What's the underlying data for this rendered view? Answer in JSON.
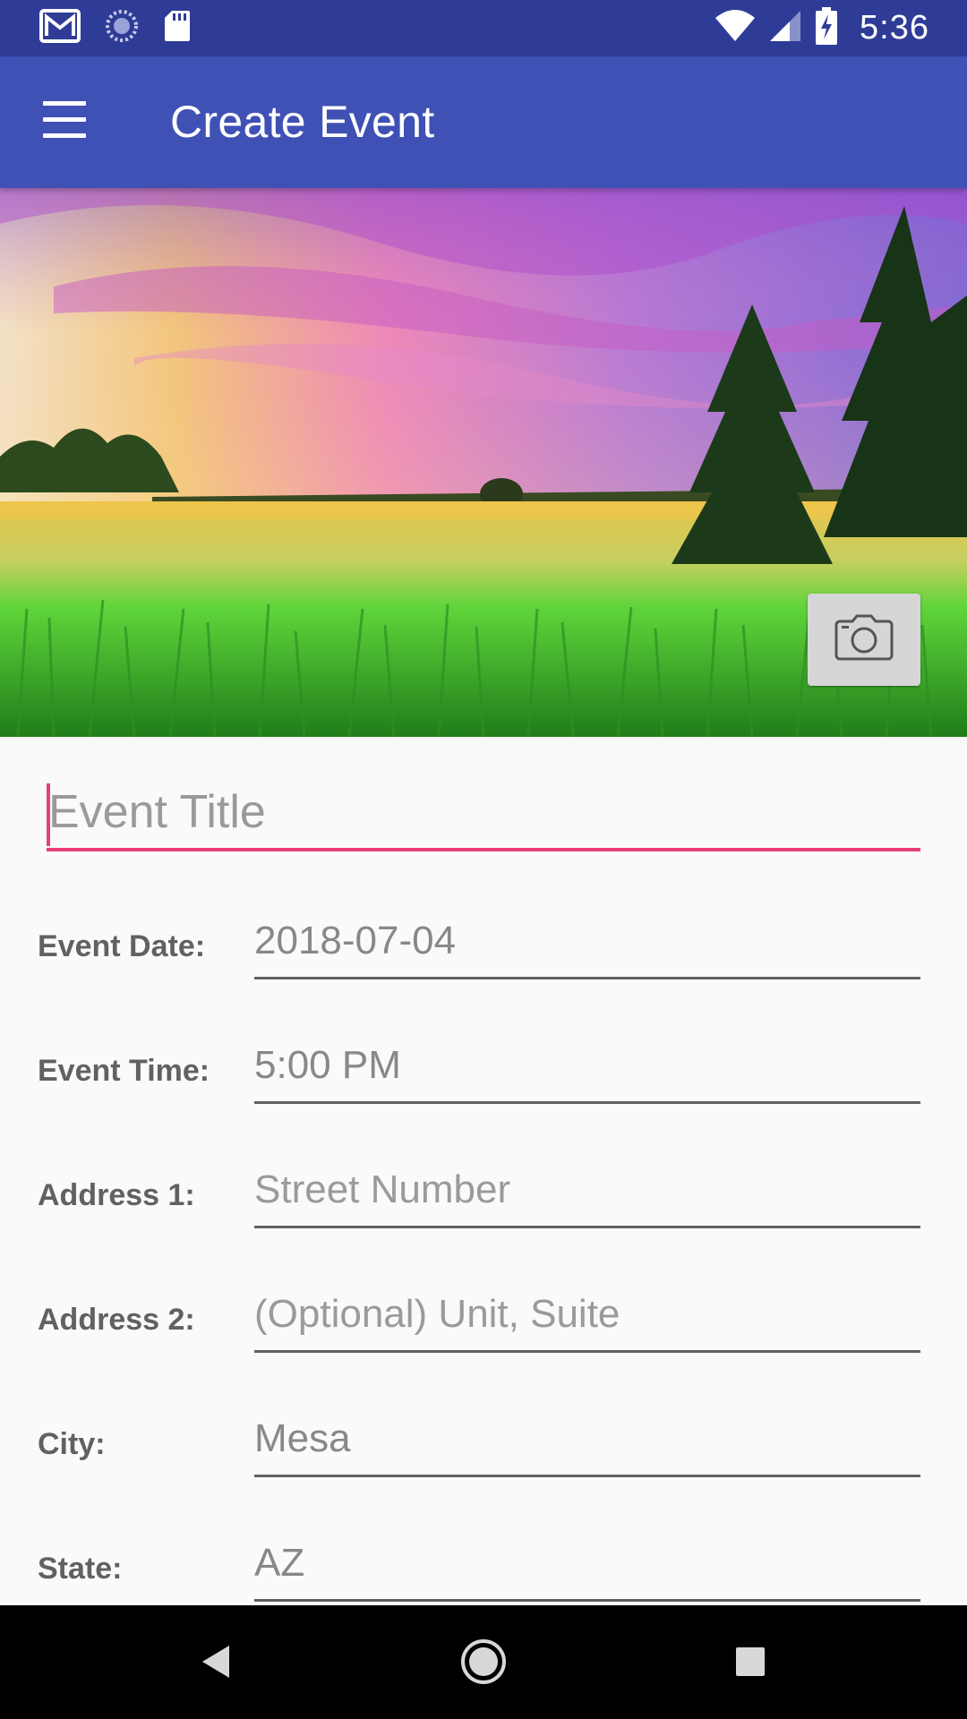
{
  "status_bar": {
    "time": "5:36",
    "left_icons": [
      "gmail-icon",
      "sync-icon",
      "sd-card-icon"
    ],
    "right_icons": [
      "wifi-icon",
      "signal-icon",
      "battery-charging-icon"
    ]
  },
  "app_bar": {
    "title": "Create Event",
    "menu_icon": "hamburger-menu-icon",
    "color": "#3f51b5"
  },
  "hero": {
    "camera_icon": "camera-icon"
  },
  "form": {
    "title_placeholder": "Event Title",
    "accent_color": "#e83e7a",
    "fields": [
      {
        "label": "Event Date:",
        "value": "2018-07-04",
        "placeholder": ""
      },
      {
        "label": "Event Time:",
        "value": "5:00 PM",
        "placeholder": ""
      },
      {
        "label": "Address 1:",
        "value": "",
        "placeholder": "Street Number"
      },
      {
        "label": "Address 2:",
        "value": "",
        "placeholder": "(Optional) Unit, Suite"
      },
      {
        "label": "City:",
        "value": "Mesa",
        "placeholder": ""
      },
      {
        "label": "State:",
        "value": "AZ",
        "placeholder": ""
      }
    ]
  },
  "nav_bar": {
    "icons": [
      "back-icon",
      "home-icon",
      "recents-icon"
    ]
  }
}
